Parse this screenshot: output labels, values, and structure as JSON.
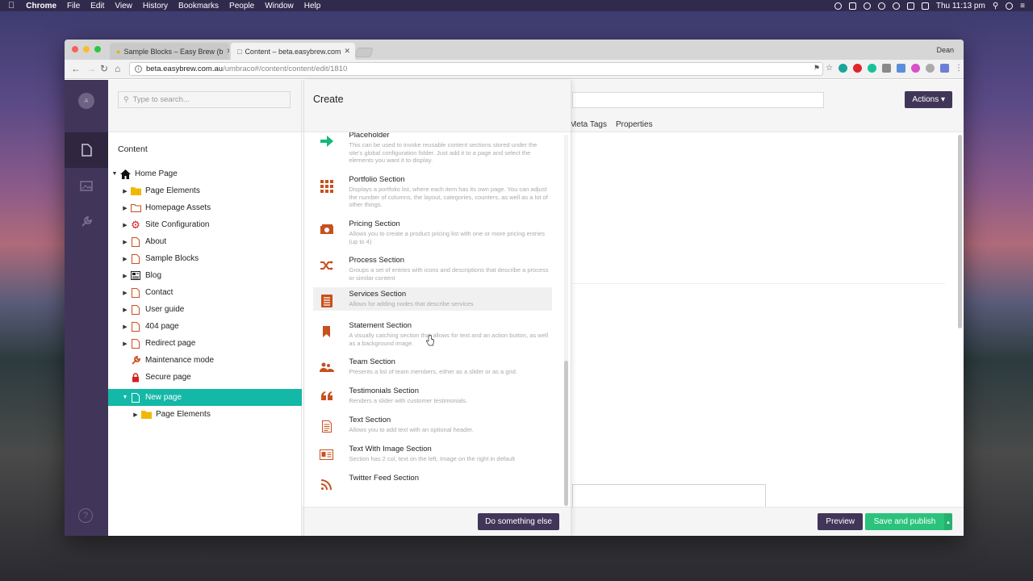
{
  "menubar": {
    "app_name": "Chrome",
    "items": [
      "File",
      "Edit",
      "View",
      "History",
      "Bookmarks",
      "People",
      "Window",
      "Help"
    ],
    "clock": "Thu 11:13 pm"
  },
  "browser": {
    "tabs": [
      {
        "label": "Sample Blocks – Easy Brew (b",
        "active": false
      },
      {
        "label": "Content – beta.easybrew.com",
        "active": true
      }
    ],
    "profile": "Dean",
    "url_host": "beta.easybrew.com.au",
    "url_path": "/umbraco#/content/content/edit/1810"
  },
  "sidebar": {
    "avatar_initial": "A",
    "help_glyph": "?"
  },
  "tree": {
    "search_placeholder": "Type to search...",
    "section_title": "Content",
    "nodes": [
      {
        "label": "Home Page",
        "icon": "home-icon"
      },
      {
        "label": "Page Elements",
        "icon": "folder-icon"
      },
      {
        "label": "Homepage Assets",
        "icon": "folder-outline-icon"
      },
      {
        "label": "Site Configuration",
        "icon": "gear-icon"
      },
      {
        "label": "About",
        "icon": "page-icon"
      },
      {
        "label": "Sample Blocks",
        "icon": "page-icon"
      },
      {
        "label": "Blog",
        "icon": "newspaper-icon"
      },
      {
        "label": "Contact",
        "icon": "page-icon"
      },
      {
        "label": "User guide",
        "icon": "page-icon"
      },
      {
        "label": "404 page",
        "icon": "page-icon"
      },
      {
        "label": "Redirect page",
        "icon": "page-icon"
      },
      {
        "label": "Maintenance mode",
        "icon": "wrench-icon"
      },
      {
        "label": "Secure page",
        "icon": "lock-icon"
      },
      {
        "label": "New page",
        "icon": "page-icon"
      },
      {
        "label": "Page Elements",
        "icon": "folder-icon"
      }
    ]
  },
  "create": {
    "title": "Create",
    "items": [
      {
        "name": "Placeholder",
        "desc": "This can be used to invoke reusable content sections stored under the site's global configuration folder. Just add it to a page and select the elements you want it to display.",
        "icon": "arrow-right-icon"
      },
      {
        "name": "Portfolio Section",
        "desc": "Displays a portfolio list, where each item has its own page. You can adjust the number of columns, the layout, categories, counters, as well as a lot of other things.",
        "icon": "grid-icon"
      },
      {
        "name": "Pricing Section",
        "desc": "Allows you to create a product pricing list with one or more pricing entries (up to 4)",
        "icon": "money-icon"
      },
      {
        "name": "Process Section",
        "desc": "Groups a set of entries with icons and descriptions that describe a process or similar content",
        "icon": "shuffle-icon"
      },
      {
        "name": "Services Section",
        "desc": "Allows for adding nodes that describe services",
        "icon": "list-icon"
      },
      {
        "name": "Statement Section",
        "desc": "A visually catching section that allows for text and an action button, as well as a background image.",
        "icon": "bookmark-icon"
      },
      {
        "name": "Team Section",
        "desc": "Presents a list of team members, either as a slider or as a grid.",
        "icon": "team-icon"
      },
      {
        "name": "Testimonials Section",
        "desc": "Renders a slider with customer testimonials.",
        "icon": "quote-icon"
      },
      {
        "name": "Text Section",
        "desc": "Allows you to add text with an optional header.",
        "icon": "document-icon"
      },
      {
        "name": "Text With Image Section",
        "desc": "Section has 2 col, text on the left, Image on the right in default",
        "icon": "id-card-icon"
      },
      {
        "name": "Twitter Feed Section",
        "desc": "",
        "icon": "rss-icon"
      }
    ],
    "footer_button": "Do something else"
  },
  "editor": {
    "actions_label": "Actions ▾",
    "tabs": [
      "Meta Tags",
      "Properties"
    ],
    "preview_label": "Preview",
    "publish_label": "Save and publish",
    "publish_caret": "▴"
  },
  "colors": {
    "brand_purple": "#413659",
    "teal_selected": "#14b8a6",
    "publish_green": "#2bc37c",
    "icon_orange": "#c8501e"
  }
}
